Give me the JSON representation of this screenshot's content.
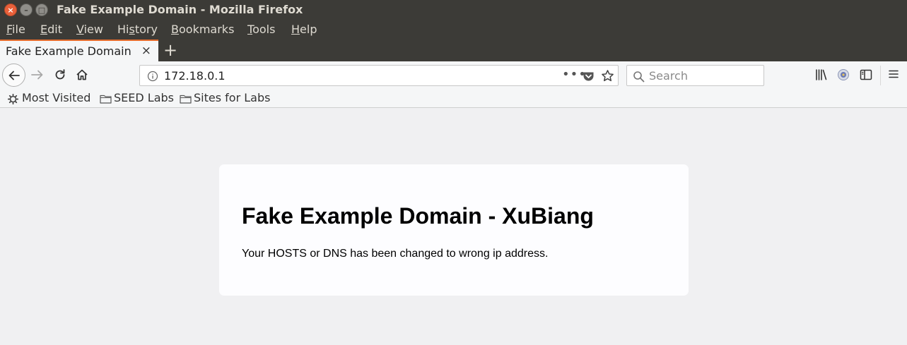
{
  "window": {
    "title": "Fake Example Domain - Mozilla Firefox",
    "close_glyph": "×",
    "min_glyph": "–",
    "max_glyph": "□"
  },
  "menu": [
    {
      "accel": "F",
      "rest": "ile"
    },
    {
      "accel": "E",
      "rest": "dit"
    },
    {
      "accel": "V",
      "rest": "iew"
    },
    {
      "pre": "Hi",
      "accel": "s",
      "rest": "tory"
    },
    {
      "accel": "B",
      "rest": "ookmarks"
    },
    {
      "accel": "T",
      "rest": "ools"
    },
    {
      "accel": "H",
      "rest": "elp"
    }
  ],
  "tab": {
    "label": "Fake Example Domain",
    "close_glyph": "×",
    "newtab_glyph": "+"
  },
  "navbar": {
    "url": "172.18.0.1",
    "url_more_glyph": "•••",
    "search_placeholder": "Search"
  },
  "bookmarks": [
    {
      "label": "Most Visited",
      "icon": "gear-icon"
    },
    {
      "label": "SEED Labs",
      "icon": "folder-icon"
    },
    {
      "label": "Sites for Labs",
      "icon": "folder-icon"
    }
  ],
  "page": {
    "heading": "Fake Example Domain - XuBiang",
    "message": "Your HOSTS or DNS has been changed to wrong ip address."
  },
  "colors": {
    "chrome_dark": "#3c3b37",
    "tab_accent": "#e66c2c",
    "close_button": "#e9603a"
  }
}
